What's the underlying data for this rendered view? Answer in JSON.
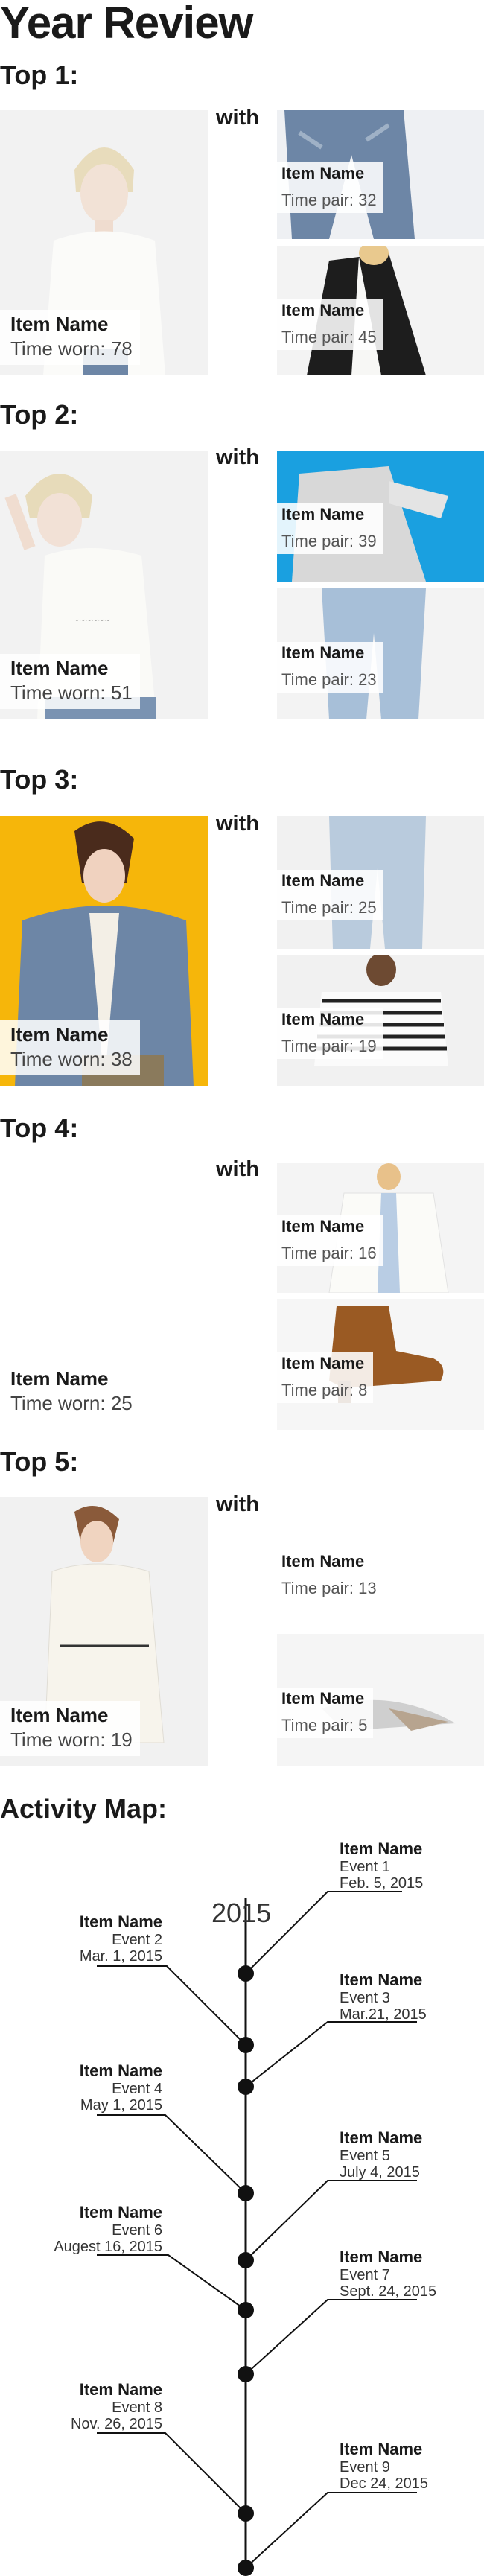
{
  "page": {
    "title": "Year Review"
  },
  "colors": {
    "accent_yellow": "#f6b60a",
    "accent_blue": "#1aa0e0",
    "denim": "#6d86a6",
    "leather": "#9a5a23"
  },
  "tops": [
    {
      "heading": "Top 1:",
      "with_label": "with",
      "main": {
        "name": "Item Name",
        "count": "Time worn: 78"
      },
      "pairs": [
        {
          "name": "Item Name",
          "count": "Time pair: 32"
        },
        {
          "name": "Item Name",
          "count": "Time pair: 45"
        }
      ]
    },
    {
      "heading": "Top 2:",
      "with_label": "with",
      "main": {
        "name": "Item Name",
        "count": "Time worn: 51"
      },
      "pairs": [
        {
          "name": "Item Name",
          "count": "Time pair: 39"
        },
        {
          "name": "Item Name",
          "count": "Time pair: 23"
        }
      ]
    },
    {
      "heading": "Top 3:",
      "with_label": "with",
      "main": {
        "name": "Item Name",
        "count": "Time worn: 38"
      },
      "pairs": [
        {
          "name": "Item Name",
          "count": "Time pair: 25"
        },
        {
          "name": "Item Name",
          "count": "Time pair: 19"
        }
      ]
    },
    {
      "heading": "Top 4:",
      "with_label": "with",
      "main": {
        "name": "Item Name",
        "count": "Time worn: 25"
      },
      "pairs": [
        {
          "name": "Item Name",
          "count": "Time pair: 16"
        },
        {
          "name": "Item Name",
          "count": "Time pair: 8"
        }
      ]
    },
    {
      "heading": "Top 5:",
      "with_label": "with",
      "main": {
        "name": "Item Name",
        "count": "Time worn: 19"
      },
      "pairs": [
        {
          "name": "Item Name",
          "count": "Time pair: 13"
        },
        {
          "name": "Item Name",
          "count": "Time pair: 5"
        }
      ]
    }
  ],
  "activity": {
    "heading": "Activity Map:",
    "year": "2015",
    "events": [
      {
        "name": "Item Name",
        "event": "Event 1",
        "date": "Feb. 5, 2015"
      },
      {
        "name": "Item Name",
        "event": "Event 2",
        "date": "Mar. 1, 2015"
      },
      {
        "name": "Item Name",
        "event": "Event 3",
        "date": "Mar.21, 2015"
      },
      {
        "name": "Item Name",
        "event": "Event 4",
        "date": "May 1, 2015"
      },
      {
        "name": "Item Name",
        "event": "Event 5",
        "date": "July 4, 2015"
      },
      {
        "name": "Item Name",
        "event": "Event 6",
        "date": "Augest 16, 2015"
      },
      {
        "name": "Item Name",
        "event": "Event 7",
        "date": "Sept. 24, 2015"
      },
      {
        "name": "Item Name",
        "event": "Event 8",
        "date": "Nov. 26, 2015"
      },
      {
        "name": "Item Name",
        "event": "Event 9",
        "date": "Dec 24, 2015"
      }
    ]
  }
}
